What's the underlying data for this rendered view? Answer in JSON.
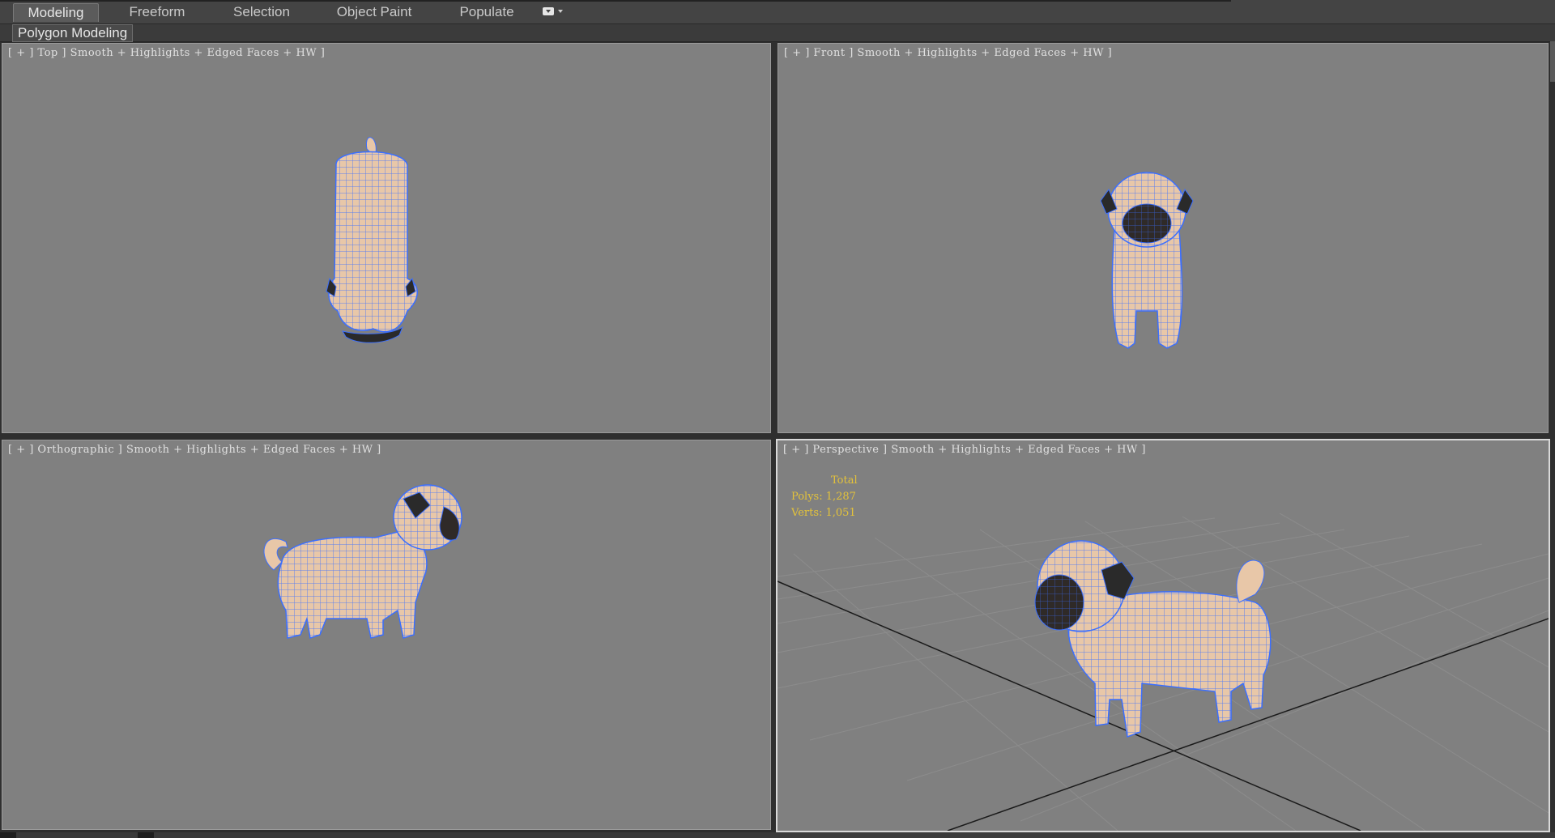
{
  "ribbon": {
    "tabs": [
      "Modeling",
      "Freeform",
      "Selection",
      "Object Paint",
      "Populate"
    ],
    "active_tab": "Modeling",
    "options_icon": "panel-options-icon"
  },
  "subbar": {
    "label": "Polygon Modeling"
  },
  "viewports": {
    "top": {
      "label": "[ + ] Top ] Smooth + Highlights + Edged Faces + HW ]"
    },
    "front": {
      "label": "[ + ] Front ] Smooth + Highlights + Edged Faces + HW ]"
    },
    "ortho": {
      "label": "[ + ] Orthographic ] Smooth + Highlights + Edged Faces + HW ]"
    },
    "perspective": {
      "label": "[ + ] Perspective ] Smooth + Highlights + Edged Faces + HW ]"
    }
  },
  "stats": {
    "total": "Total",
    "polys": "Polys: 1,287",
    "verts": "Verts: 1,051"
  },
  "colors": {
    "viewport_bg": "#808080",
    "wireframe": "#3b6fff",
    "skin": "#e8c7a8",
    "face_dark": "#2a2a2a",
    "stats_text": "#e3c23a",
    "grid": "#8c8c8c"
  }
}
